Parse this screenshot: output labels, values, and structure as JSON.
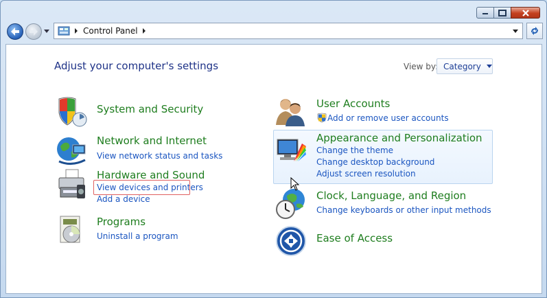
{
  "window": {
    "controls": [
      "minimize",
      "maximize",
      "close"
    ]
  },
  "address": {
    "path": [
      "Control Panel"
    ]
  },
  "heading": "Adjust your computer's settings",
  "view_by": {
    "label": "View by:",
    "value": "Category"
  },
  "categories": [
    {
      "title": "System and Security",
      "icon": "shield-icon",
      "links": []
    },
    {
      "title": "Network and Internet",
      "icon": "network-globe-icon",
      "links": [
        "View network status and tasks"
      ]
    },
    {
      "title": "Hardware and Sound",
      "icon": "printer-speaker-icon",
      "links": [
        "View devices and printers",
        "Add a device"
      ]
    },
    {
      "title": "Programs",
      "icon": "programs-disc-icon",
      "links": [
        "Uninstall a program"
      ]
    },
    {
      "title": "User Accounts",
      "icon": "users-icon",
      "links": [
        "Add or remove user accounts"
      ]
    },
    {
      "title": "Appearance and Personalization",
      "icon": "monitor-palette-icon",
      "links": [
        "Change the theme",
        "Change desktop background",
        "Adjust screen resolution"
      ]
    },
    {
      "title": "Clock, Language, and Region",
      "icon": "clock-globe-icon",
      "links": [
        "Change keyboards or other input methods"
      ]
    },
    {
      "title": "Ease of Access",
      "icon": "ease-of-access-icon",
      "links": []
    }
  ],
  "colors": {
    "category_title": "#1e7d1e",
    "link": "#1a55c0",
    "heading": "#1e3287",
    "highlight_border": "#e06060"
  }
}
